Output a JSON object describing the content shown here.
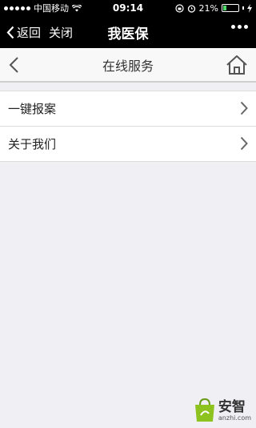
{
  "status_bar": {
    "carrier": "中国移动",
    "time": "09:14",
    "battery_percent": "21%",
    "battery_level": 0.21
  },
  "wechat_bar": {
    "back_label": "返回",
    "close_label": "关闭",
    "title": "我医保"
  },
  "app_header": {
    "title": "在线服务"
  },
  "list": {
    "items": [
      {
        "label": "一键报案"
      },
      {
        "label": "关于我们"
      }
    ]
  },
  "watermark": {
    "brand": "安智",
    "url": "anzhi.com"
  },
  "colors": {
    "bar_bg": "#000000",
    "page_bg": "#efeff4",
    "battery": "#4cd964",
    "watermark_green": "#8dc21f"
  }
}
